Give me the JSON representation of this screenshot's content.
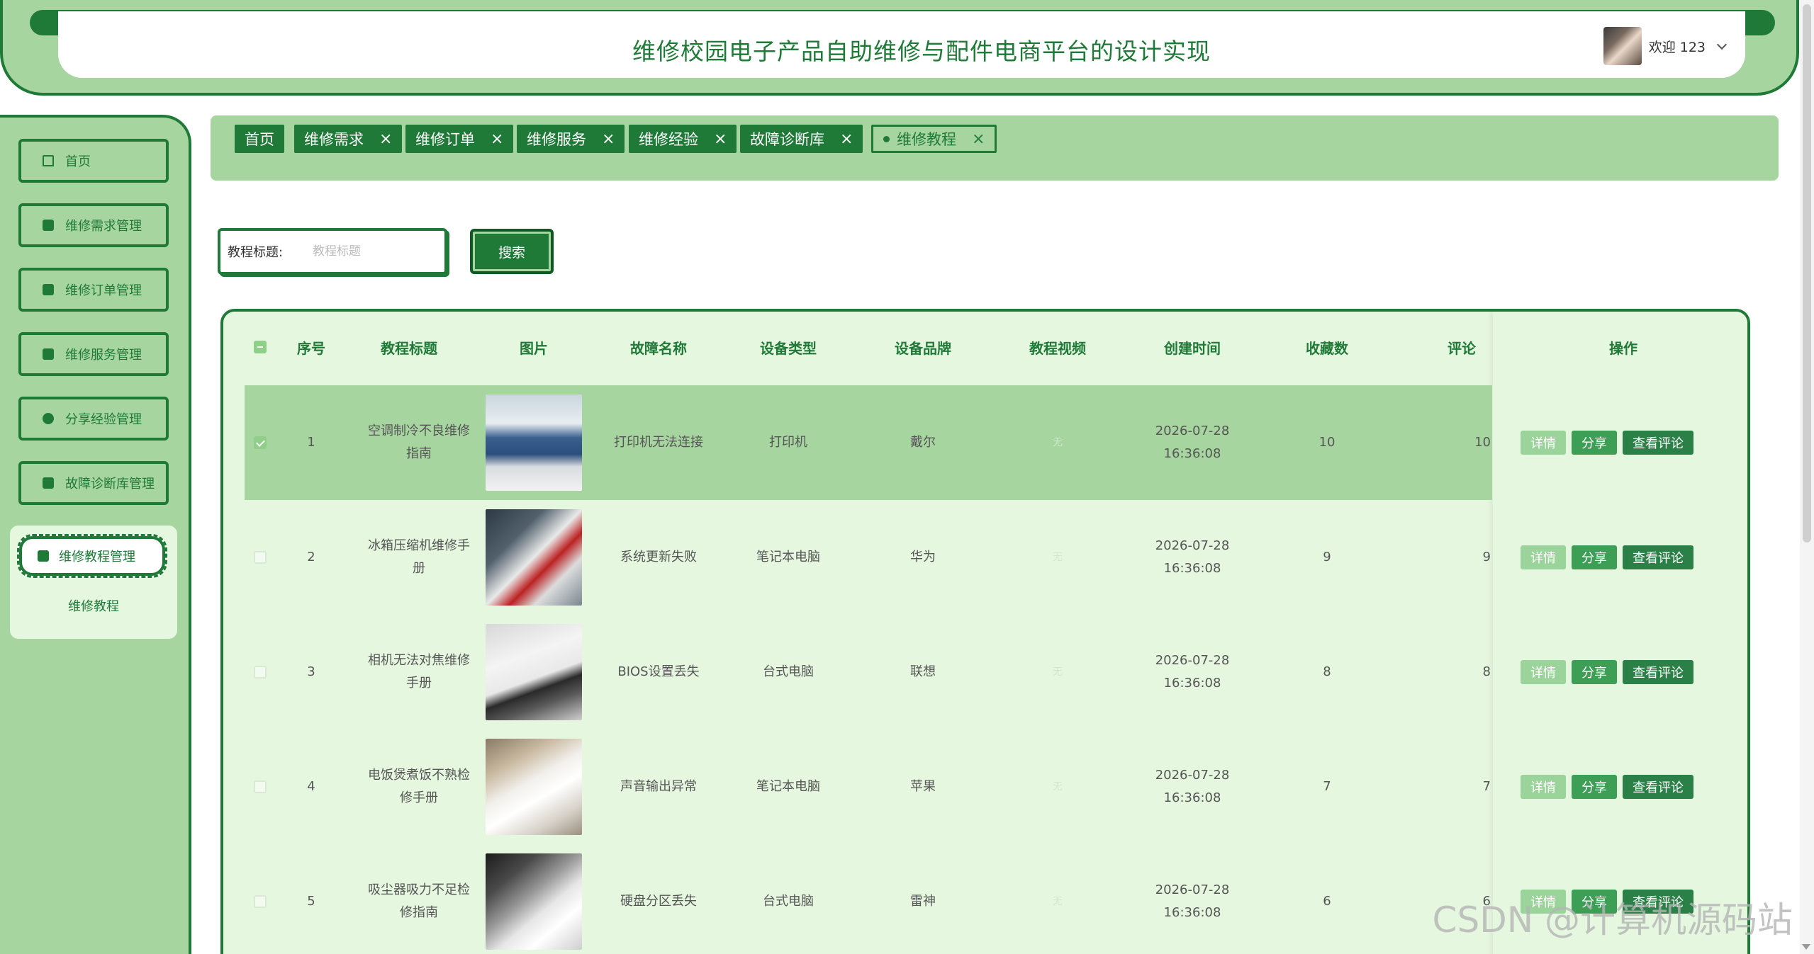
{
  "header": {
    "title": "维修校园电子产品自助维修与配件电商平台的设计实现",
    "welcome": "欢迎 123"
  },
  "sidebar": {
    "items": [
      {
        "label": "首页",
        "icon": "home-icon"
      },
      {
        "label": "维修需求管理",
        "icon": "chip-icon"
      },
      {
        "label": "维修订单管理",
        "icon": "bookmark-icon"
      },
      {
        "label": "维修服务管理",
        "icon": "folder-icon"
      },
      {
        "label": "分享经验管理",
        "icon": "check-circle-icon"
      },
      {
        "label": "故障诊断库管理",
        "icon": "bookmark-icon"
      }
    ],
    "active": {
      "label": "维修教程管理",
      "icon": "document-icon"
    },
    "sub": "维修教程"
  },
  "tabs": [
    {
      "label": "首页",
      "closable": false
    },
    {
      "label": "维修需求",
      "closable": true
    },
    {
      "label": "维修订单",
      "closable": true
    },
    {
      "label": "维修服务",
      "closable": true
    },
    {
      "label": "维修经验",
      "closable": true
    },
    {
      "label": "故障诊断库",
      "closable": true
    },
    {
      "label": "维修教程",
      "closable": true,
      "active": true
    }
  ],
  "search": {
    "label": "教程标题:",
    "placeholder": "教程标题",
    "button": "搜索"
  },
  "table": {
    "columns": [
      "序号",
      "教程标题",
      "图片",
      "故障名称",
      "设备类型",
      "设备品牌",
      "教程视频",
      "创建时间",
      "收藏数",
      "评论",
      "操作"
    ],
    "rows": [
      {
        "no": "1",
        "title": "空调制冷不良维修指南",
        "fault": "打印机无法连接",
        "type": "打印机",
        "brand": "戴尔",
        "video": "无",
        "time": "2026-07-28 16:36:08",
        "fav": "10",
        "comment": "10",
        "selected": true
      },
      {
        "no": "2",
        "title": "冰箱压缩机维修手册",
        "fault": "系统更新失败",
        "type": "笔记本电脑",
        "brand": "华为",
        "video": "无",
        "time": "2026-07-28 16:36:08",
        "fav": "9",
        "comment": "9",
        "selected": false
      },
      {
        "no": "3",
        "title": "相机无法对焦维修手册",
        "fault": "BIOS设置丢失",
        "type": "台式电脑",
        "brand": "联想",
        "video": "无",
        "time": "2026-07-28 16:36:08",
        "fav": "8",
        "comment": "8",
        "selected": false
      },
      {
        "no": "4",
        "title": "电饭煲煮饭不熟检修手册",
        "fault": "声音输出异常",
        "type": "笔记本电脑",
        "brand": "苹果",
        "video": "无",
        "time": "2026-07-28 16:36:08",
        "fav": "7",
        "comment": "7",
        "selected": false
      },
      {
        "no": "5",
        "title": "吸尘器吸力不足检修指南",
        "fault": "硬盘分区丢失",
        "type": "台式电脑",
        "brand": "雷神",
        "video": "无",
        "time": "2026-07-28 16:36:08",
        "fav": "6",
        "comment": "6",
        "selected": false
      }
    ],
    "actions": {
      "detail": "详情",
      "share": "分享",
      "comment": "查看评论"
    }
  },
  "watermark": "CSDN @计算机源码站",
  "colors": {
    "primary": "#1f7a38",
    "light": "#a6d5a0",
    "pale": "#e6f7e0"
  }
}
